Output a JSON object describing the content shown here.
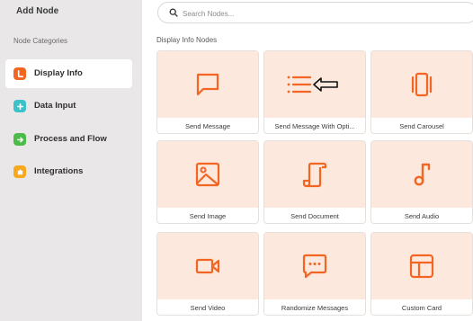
{
  "sidebar": {
    "title": "Add Node",
    "subtitle": "Node Categories",
    "categories": [
      {
        "label": "Display Info",
        "icon": "message-icon",
        "color": "#f26522"
      },
      {
        "label": "Data Input",
        "icon": "plus-icon",
        "color": "#3bc2c8"
      },
      {
        "label": "Process and Flow",
        "icon": "arrow-right-icon",
        "color": "#4cbb47"
      },
      {
        "label": "Integrations",
        "icon": "puzzle-icon",
        "color": "#f7a81b"
      }
    ]
  },
  "search": {
    "placeholder": "Search Nodes..."
  },
  "main": {
    "section_title": "Display Info Nodes",
    "cards": [
      {
        "label": "Send Message",
        "icon": "message-square-icon"
      },
      {
        "label": "Send Message With Opti...",
        "icon": "list-icon"
      },
      {
        "label": "Send Carousel",
        "icon": "carousel-icon"
      },
      {
        "label": "Send Image",
        "icon": "image-icon"
      },
      {
        "label": "Send Document",
        "icon": "scroll-icon"
      },
      {
        "label": "Send Audio",
        "icon": "music-note-icon"
      },
      {
        "label": "Send Video",
        "icon": "video-icon"
      },
      {
        "label": "Randomize Messages",
        "icon": "chat-dots-icon"
      },
      {
        "label": "Custom Card",
        "icon": "layout-icon"
      }
    ]
  },
  "colors": {
    "accent": "#f26522",
    "card_bg": "#fde8dd",
    "sidebar_bg": "#e9e7e7"
  }
}
